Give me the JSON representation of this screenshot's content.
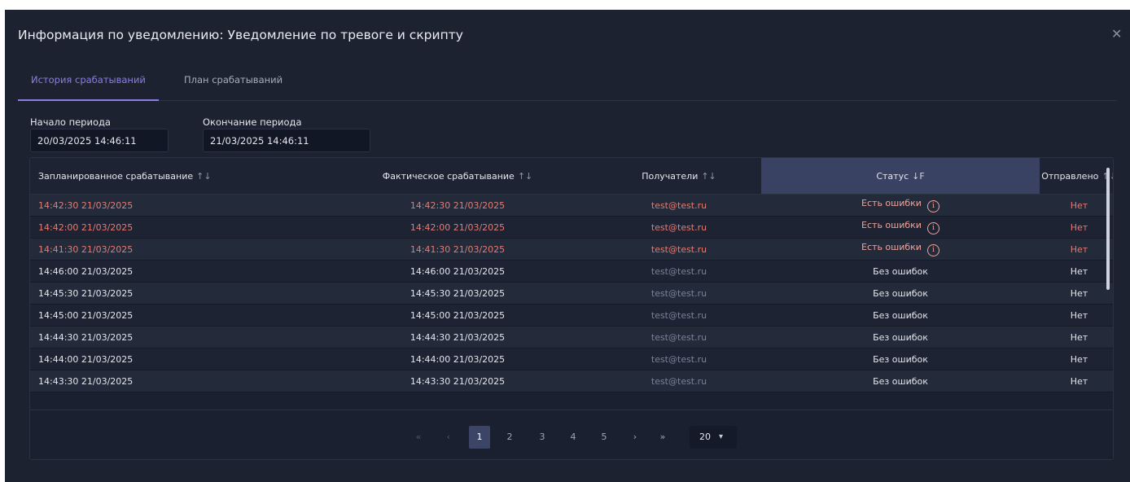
{
  "dialog": {
    "title": "Информация по уведомлению: Уведомление по тревоге и скрипту",
    "close_icon": "close-icon"
  },
  "tabs": [
    {
      "label": "История срабатываний",
      "active": true
    },
    {
      "label": "План срабатываний",
      "active": false
    }
  ],
  "period": {
    "start_label": "Начало периода",
    "start_value": "20/03/2025 14:46:11",
    "end_label": "Окончание периода",
    "end_value": "21/03/2025 14:46:11"
  },
  "table": {
    "columns": [
      {
        "label": "Запланированное срабатывание",
        "sort": "↑↓"
      },
      {
        "label": "Фактическое срабатывание",
        "sort": "↑↓"
      },
      {
        "label": "Получатели",
        "sort": "↑↓"
      },
      {
        "label": "Статус",
        "sort": "↓F"
      },
      {
        "label": "Отправлено",
        "sort": "↑↓"
      }
    ],
    "rows": [
      {
        "planned": "14:42:30 21/03/2025",
        "actual": "14:42:30 21/03/2025",
        "recipients": "test@test.ru",
        "status": "Есть ошибки",
        "sent": "Нет",
        "error": true
      },
      {
        "planned": "14:42:00 21/03/2025",
        "actual": "14:42:00 21/03/2025",
        "recipients": "test@test.ru",
        "status": "Есть ошибки",
        "sent": "Нет",
        "error": true
      },
      {
        "planned": "14:41:30 21/03/2025",
        "actual": "14:41:30 21/03/2025",
        "recipients": "test@test.ru",
        "status": "Есть ошибки",
        "sent": "Нет",
        "error": true
      },
      {
        "planned": "14:46:00 21/03/2025",
        "actual": "14:46:00 21/03/2025",
        "recipients": "test@test.ru",
        "status": "Без ошибок",
        "sent": "Нет",
        "error": false
      },
      {
        "planned": "14:45:30 21/03/2025",
        "actual": "14:45:30 21/03/2025",
        "recipients": "test@test.ru",
        "status": "Без ошибок",
        "sent": "Нет",
        "error": false
      },
      {
        "planned": "14:45:00 21/03/2025",
        "actual": "14:45:00 21/03/2025",
        "recipients": "test@test.ru",
        "status": "Без ошибок",
        "sent": "Нет",
        "error": false
      },
      {
        "planned": "14:44:30 21/03/2025",
        "actual": "14:44:30 21/03/2025",
        "recipients": "test@test.ru",
        "status": "Без ошибок",
        "sent": "Нет",
        "error": false
      },
      {
        "planned": "14:44:00 21/03/2025",
        "actual": "14:44:00 21/03/2025",
        "recipients": "test@test.ru",
        "status": "Без ошибок",
        "sent": "Нет",
        "error": false
      },
      {
        "planned": "14:43:30 21/03/2025",
        "actual": "14:43:30 21/03/2025",
        "recipients": "test@test.ru",
        "status": "Без ошибок",
        "sent": "Нет",
        "error": false
      }
    ]
  },
  "pagination": {
    "first": "«",
    "prev": "‹",
    "pages": [
      "1",
      "2",
      "3",
      "4",
      "5"
    ],
    "current": "1",
    "next": "›",
    "last": "»",
    "page_size": "20"
  },
  "colors": {
    "background": "#1c2230",
    "accent": "#8b7fe0",
    "error": "#e37c74",
    "active_header": "#3a4263"
  }
}
